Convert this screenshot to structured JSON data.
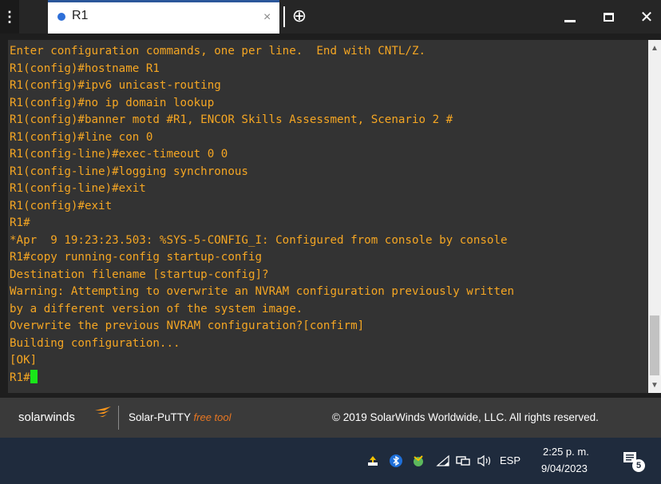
{
  "window": {
    "menu_icon": "⋮",
    "tab_title": "R1",
    "tab_close": "×",
    "new_tab": "⊕",
    "close_glyph": "✕",
    "accent_color": "#2e6fd8"
  },
  "terminal": {
    "text_color": "#f5a623",
    "cursor_color": "#19e619",
    "lines": [
      "Enter configuration commands, one per line.  End with CNTL/Z.",
      "R1(config)#hostname R1",
      "R1(config)#ipv6 unicast-routing",
      "R1(config)#no ip domain lookup",
      "R1(config)#banner motd #R1, ENCOR Skills Assessment, Scenario 2 #",
      "R1(config)#line con 0",
      "R1(config-line)#exec-timeout 0 0",
      "R1(config-line)#logging synchronous",
      "R1(config-line)#exit",
      "R1(config)#exit",
      "R1#",
      "*Apr  9 19:23:23.503: %SYS-5-CONFIG_I: Configured from console by console",
      "R1#copy running-config startup-config",
      "Destination filename [startup-config]?",
      "Warning: Attempting to overwrite an NVRAM configuration previously written",
      "by a different version of the system image.",
      "Overwrite the previous NVRAM configuration?[confirm]",
      "Building configuration...",
      "[OK]"
    ],
    "prompt": "R1#"
  },
  "footer": {
    "logo_text": "solarwinds",
    "product_name": "Solar-PuTTY",
    "product_tag": "free tool",
    "copyright": "© 2019 SolarWinds Worldwide, LLC. All rights reserved."
  },
  "taskbar": {
    "language": "ESP",
    "time": "2:25 p. m.",
    "date": "9/04/2023",
    "notification_count": "5",
    "tray_icons": [
      "upload-icon",
      "bluetooth-icon",
      "security-icon",
      "wifi-icon",
      "network-icon",
      "volume-icon"
    ]
  }
}
